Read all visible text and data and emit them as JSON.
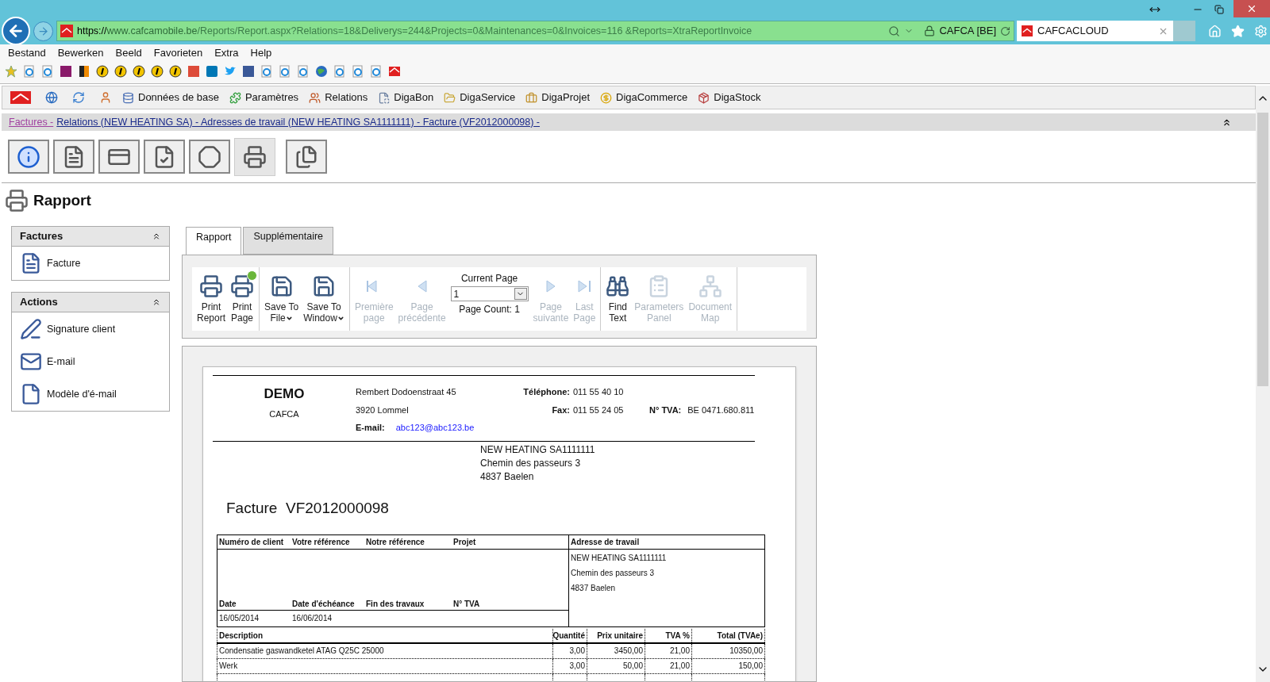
{
  "browser": {
    "url_scheme": "https://",
    "url_host": "www.cafcamobile.be",
    "url_path": "/Reports/Report.aspx?Relations=18&Deliverys=244&Projects=0&Maintenances=0&Invoices=116 &Reports=XtraReportInvoice",
    "site_label": "CAFCA [BE]",
    "tab_title": "CAFCACLOUD",
    "menu": [
      "Bestand",
      "Bewerken",
      "Beeld",
      "Favorieten",
      "Extra",
      "Help"
    ]
  },
  "app_nav": [
    "Données de base",
    "Paramètres",
    "Relations",
    "DigaBon",
    "DigaService",
    "DigaProjet",
    "DigaCommerce",
    "DigaStock"
  ],
  "breadcrumb": [
    {
      "label": "Factures -",
      "visited": true
    },
    {
      "label": "Relations (NEW HEATING SA) - Adresses de travail (NEW HEATING SA1111111) - Facture (VF2012000098) -",
      "visited": false
    }
  ],
  "icon_buttons": [
    {
      "selected": false
    },
    {
      "selected": false
    },
    {
      "selected": false
    },
    {
      "selected": false
    },
    {
      "selected": false
    },
    {
      "selected": true
    },
    {
      "selected": false
    }
  ],
  "page_title": "Rapport",
  "panels": [
    {
      "title": "Factures",
      "expanded": true,
      "items": [
        "Facture"
      ]
    },
    {
      "title": "Actions",
      "expanded": true,
      "items": [
        "Signature client",
        "E-mail",
        "Modèle d'é-mail"
      ]
    }
  ],
  "tabs": [
    {
      "label": "Rapport",
      "selected": true
    },
    {
      "label": "Supplémentaire",
      "selected": false
    }
  ],
  "toolbar": [
    {
      "items": [
        {
          "kind": "button",
          "lines": [
            "Print",
            "Report"
          ],
          "disabled": false,
          "dropdown": false
        },
        {
          "kind": "button",
          "lines": [
            "Print",
            "Page"
          ],
          "disabled": false,
          "dropdown": false
        }
      ]
    },
    {
      "items": [
        {
          "kind": "button",
          "lines": [
            "Save To",
            "File"
          ],
          "disabled": false,
          "dropdown": true
        },
        {
          "kind": "button",
          "lines": [
            "Save To",
            "Window"
          ],
          "disabled": false,
          "dropdown": true
        }
      ]
    },
    {
      "items": [
        {
          "kind": "button",
          "lines": [
            "Première",
            "page"
          ],
          "disabled": true,
          "dropdown": false
        },
        {
          "kind": "button",
          "lines": [
            "Page",
            "précédente"
          ],
          "disabled": true,
          "dropdown": false
        },
        {
          "kind": "pager",
          "label": "Current Page",
          "value": "1",
          "count": "Page Count: 1"
        },
        {
          "kind": "button",
          "lines": [
            "Page",
            "suivante"
          ],
          "disabled": true,
          "dropdown": false
        },
        {
          "kind": "button",
          "lines": [
            "Last",
            "Page"
          ],
          "disabled": true,
          "dropdown": false
        }
      ]
    },
    {
      "items": [
        {
          "kind": "button",
          "lines": [
            "Find",
            "Text"
          ],
          "disabled": false,
          "dropdown": false
        },
        {
          "kind": "button",
          "lines": [
            "Parameters",
            "Panel"
          ],
          "disabled": true,
          "dropdown": false
        },
        {
          "kind": "button",
          "lines": [
            "Document",
            "Map"
          ],
          "disabled": true,
          "dropdown": false
        }
      ]
    }
  ],
  "invoice": {
    "company": "DEMO",
    "company_sub": "CAFCA",
    "address": [
      "Rembert Dodoenstraat 45",
      "3920 Lommel"
    ],
    "email_label": "E-mail:",
    "email": "abc123@abc123.be",
    "phone_label": "Téléphone:",
    "phone": "011 55 40 10",
    "fax_label": "Fax:",
    "fax": "011 55 24 05",
    "vat_label": "N° TVA:",
    "vat": "BE 0471.680.811",
    "recipient": [
      "NEW HEATING SA1111111",
      "Chemin des passeurs 3",
      "4837 Baelen"
    ],
    "title": "Facture  VF2012000098",
    "info_headers": [
      "Numéro de client",
      "Votre référence",
      "Notre référence",
      "Projet"
    ],
    "date_headers": [
      "Date",
      "Date d'échéance",
      "Fin des travaux",
      "N° TVA"
    ],
    "date_values": [
      "16/05/2014",
      "16/06/2014"
    ],
    "work_address_title": "Adresse de travail",
    "work_address": [
      "NEW HEATING SA1111111",
      "Chemin des passeurs 3",
      "4837 Baelen"
    ],
    "columns": [
      "Description",
      "Quantité",
      "Prix unitaire",
      "TVA %",
      "Total (TVAe)"
    ],
    "rows": [
      [
        "Condensatie gaswandketel ATAG Q25C 25000",
        "3,00",
        "3450,00",
        "21,00",
        "10350,00"
      ],
      [
        "Werk",
        "3,00",
        "50,00",
        "21,00",
        "150,00"
      ]
    ]
  }
}
